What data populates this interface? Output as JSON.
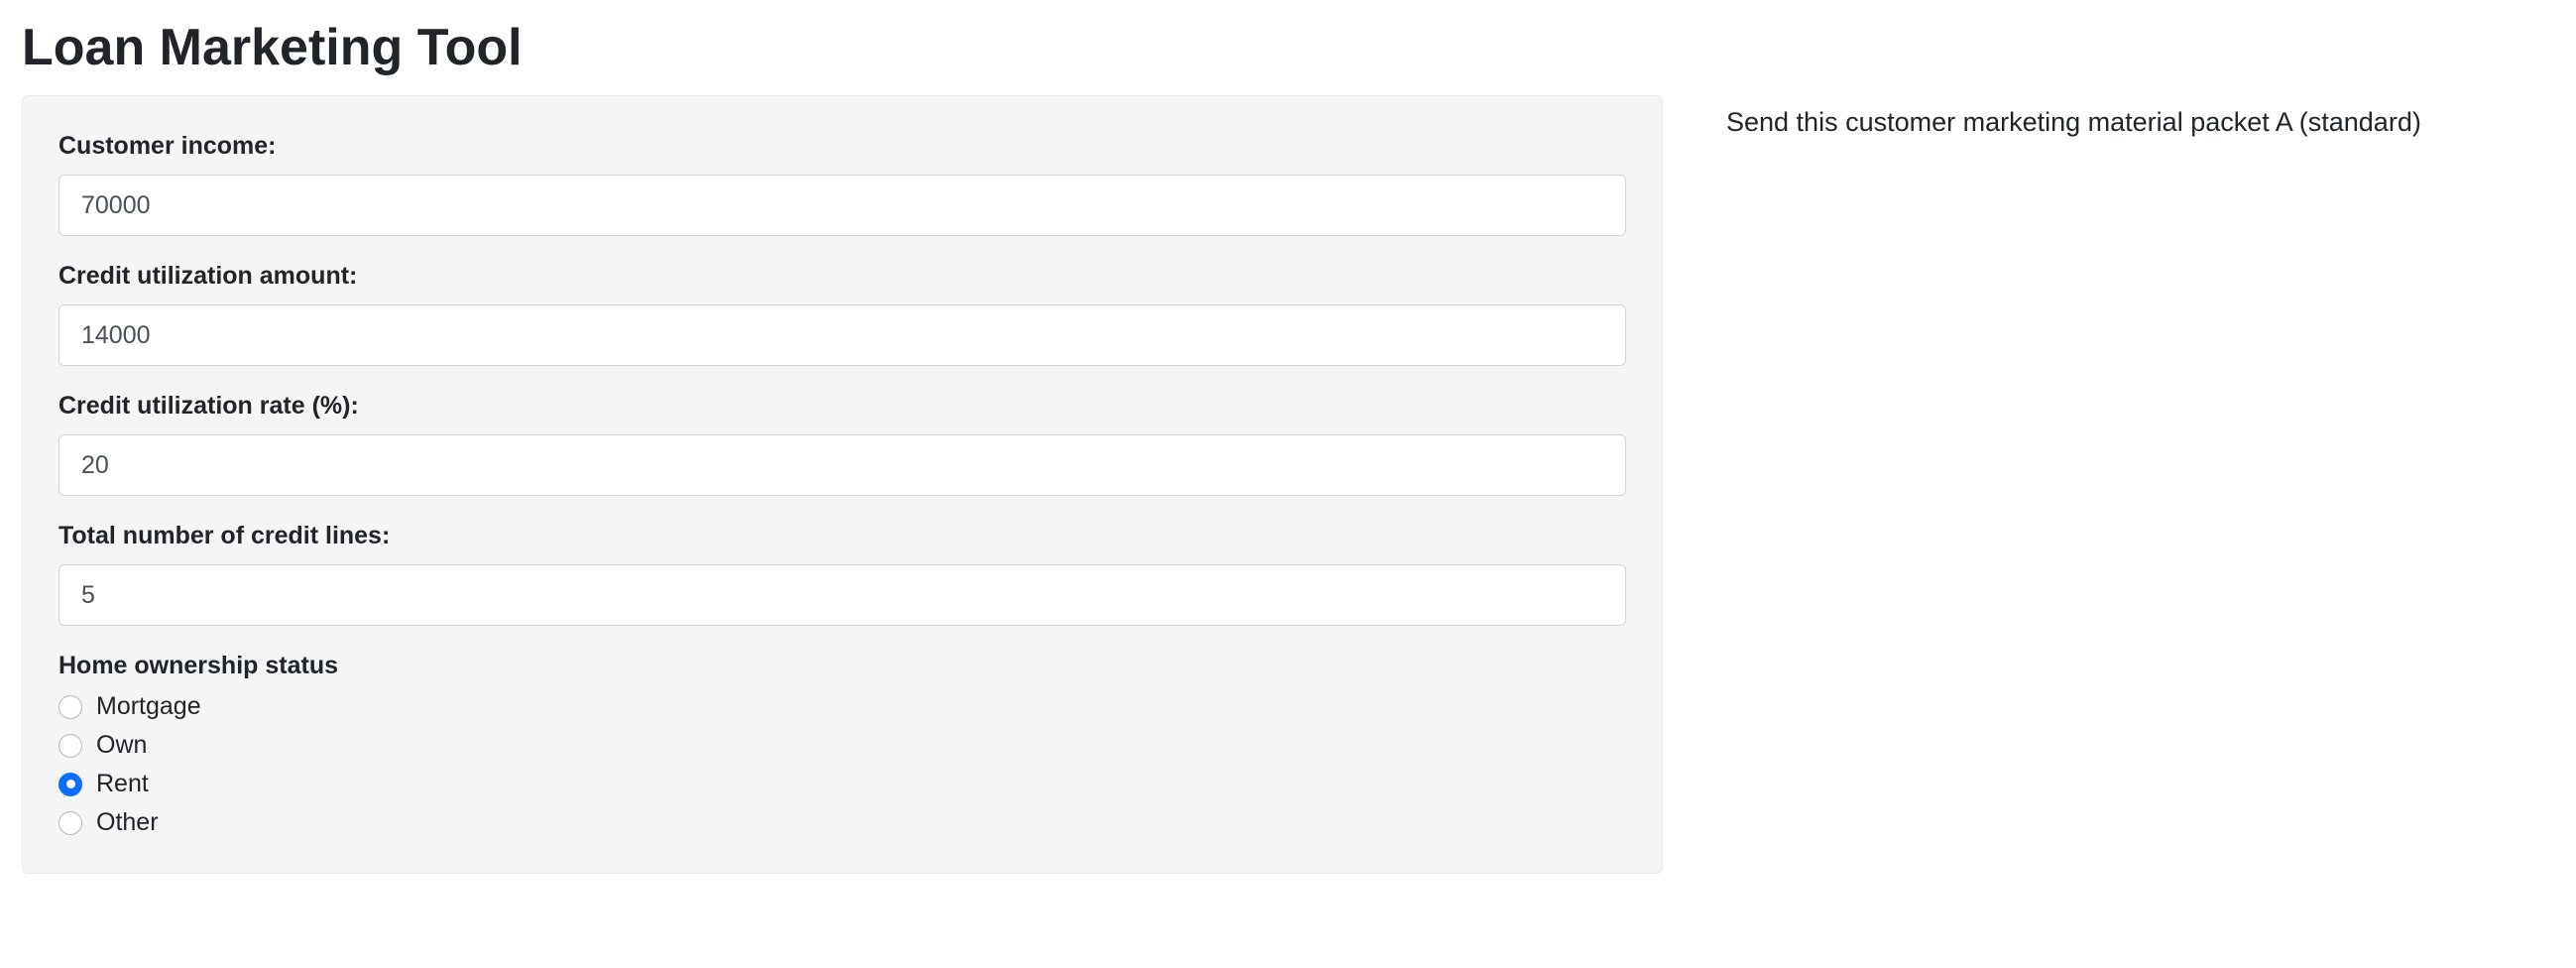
{
  "header": {
    "title": "Loan Marketing Tool"
  },
  "form": {
    "income": {
      "label": "Customer income:",
      "value": "70000"
    },
    "credit_util_amount": {
      "label": "Credit utilization amount:",
      "value": "14000"
    },
    "credit_util_rate": {
      "label": "Credit utilization rate (%):",
      "value": "20"
    },
    "credit_lines": {
      "label": "Total number of credit lines:",
      "value": "5"
    },
    "home_ownership": {
      "label": "Home ownership status",
      "options": [
        {
          "label": "Mortgage",
          "checked": false
        },
        {
          "label": "Own",
          "checked": false
        },
        {
          "label": "Rent",
          "checked": true
        },
        {
          "label": "Other",
          "checked": false
        }
      ]
    }
  },
  "output": {
    "message": "Send this customer marketing material packet A (standard)"
  }
}
